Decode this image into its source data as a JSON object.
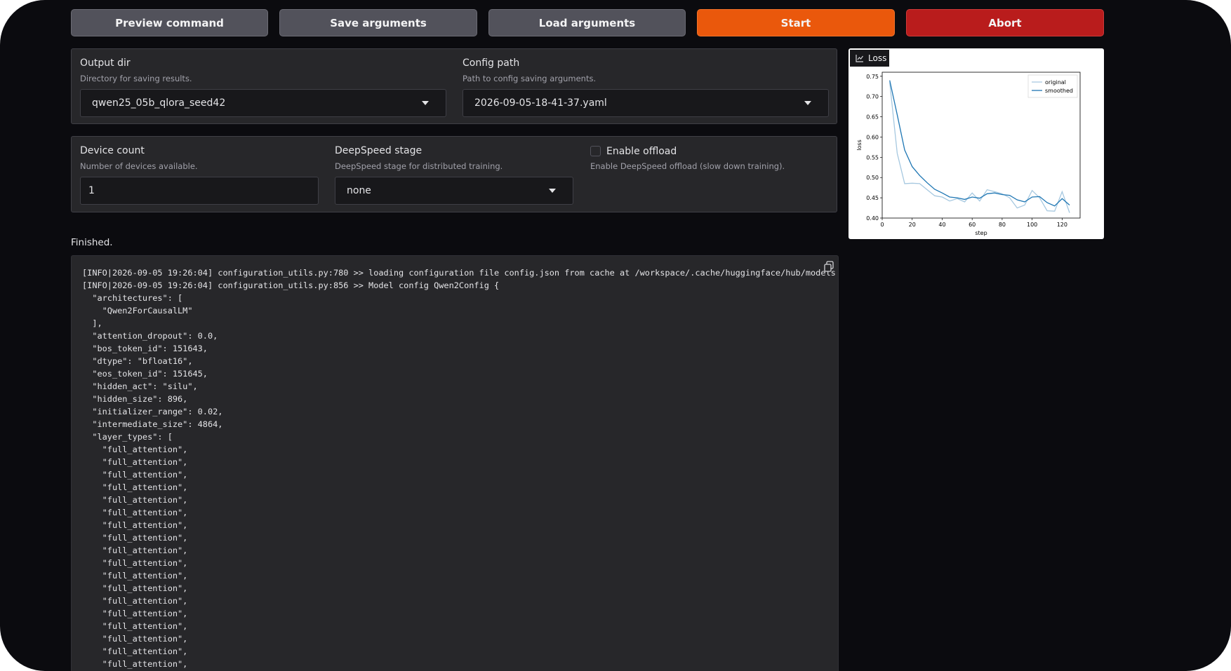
{
  "toolbar": {
    "preview_label": "Preview command",
    "save_label": "Save arguments",
    "load_label": "Load arguments",
    "start_label": "Start",
    "abort_label": "Abort"
  },
  "output": {
    "dir_label": "Output dir",
    "dir_info": "Directory for saving results.",
    "dir_value": "qwen25_05b_qlora_seed42",
    "config_label": "Config path",
    "config_info": "Path to config saving arguments.",
    "config_value": "2026-09-05-18-41-37.yaml"
  },
  "device": {
    "count_label": "Device count",
    "count_info": "Number of devices available.",
    "count_value": "1",
    "ds_label": "DeepSpeed stage",
    "ds_info": "DeepSpeed stage for distributed training.",
    "ds_value": "none",
    "offload_label": "Enable offload",
    "offload_info": "Enable DeepSpeed offload (slow down training).",
    "offload_checked": false
  },
  "status": {
    "text": "Finished."
  },
  "log": {
    "lines": [
      "[INFO|2026-09-05 19:26:04] configuration_utils.py:780 >> loading configuration file config.json from cache at /workspace/.cache/huggingface/hub/models",
      "[INFO|2026-09-05 19:26:04] configuration_utils.py:856 >> Model config Qwen2Config {",
      "  \"architectures\": [",
      "    \"Qwen2ForCausalLM\"",
      "  ],",
      "  \"attention_dropout\": 0.0,",
      "  \"bos_token_id\": 151643,",
      "  \"dtype\": \"bfloat16\",",
      "  \"eos_token_id\": 151645,",
      "  \"hidden_act\": \"silu\",",
      "  \"hidden_size\": 896,",
      "  \"initializer_range\": 0.02,",
      "  \"intermediate_size\": 4864,",
      "  \"layer_types\": [",
      "    \"full_attention\",",
      "    \"full_attention\",",
      "    \"full_attention\",",
      "    \"full_attention\",",
      "    \"full_attention\",",
      "    \"full_attention\",",
      "    \"full_attention\",",
      "    \"full_attention\",",
      "    \"full_attention\",",
      "    \"full_attention\",",
      "    \"full_attention\",",
      "    \"full_attention\",",
      "    \"full_attention\",",
      "    \"full_attention\",",
      "    \"full_attention\",",
      "    \"full_attention\",",
      "    \"full_attention\",",
      "    \"full_attention\","
    ]
  },
  "plot": {
    "tab_label": "Loss",
    "icon": "chart-icon"
  },
  "chart_data": {
    "type": "line",
    "title": "",
    "xlabel": "step",
    "ylabel": "loss",
    "xlim": [
      0,
      132
    ],
    "ylim": [
      0.4,
      0.76
    ],
    "xticks": [
      0,
      20,
      40,
      60,
      80,
      100,
      120
    ],
    "yticks": [
      0.4,
      0.45,
      0.5,
      0.55,
      0.6,
      0.65,
      0.7,
      0.75
    ],
    "legend_position": "top-right",
    "grid": false,
    "series": [
      {
        "name": "original",
        "color": "#a6c8e0",
        "x": [
          5,
          10,
          15,
          20,
          25,
          30,
          35,
          40,
          45,
          50,
          55,
          60,
          65,
          70,
          75,
          80,
          85,
          90,
          95,
          100,
          105,
          110,
          115,
          120,
          125
        ],
        "y": [
          0.735,
          0.56,
          0.485,
          0.486,
          0.485,
          0.47,
          0.455,
          0.452,
          0.442,
          0.448,
          0.44,
          0.462,
          0.442,
          0.47,
          0.465,
          0.46,
          0.45,
          0.425,
          0.432,
          0.468,
          0.45,
          0.418,
          0.417,
          0.465,
          0.413
        ]
      },
      {
        "name": "smoothed",
        "color": "#1f77b4",
        "x": [
          5,
          10,
          15,
          20,
          25,
          30,
          35,
          40,
          45,
          50,
          55,
          60,
          65,
          70,
          75,
          80,
          85,
          90,
          95,
          100,
          105,
          110,
          115,
          120,
          125
        ],
        "y": [
          0.74,
          0.655,
          0.568,
          0.527,
          0.505,
          0.487,
          0.471,
          0.462,
          0.452,
          0.45,
          0.446,
          0.452,
          0.449,
          0.46,
          0.462,
          0.458,
          0.456,
          0.445,
          0.44,
          0.452,
          0.453,
          0.438,
          0.43,
          0.448,
          0.432
        ]
      }
    ]
  }
}
